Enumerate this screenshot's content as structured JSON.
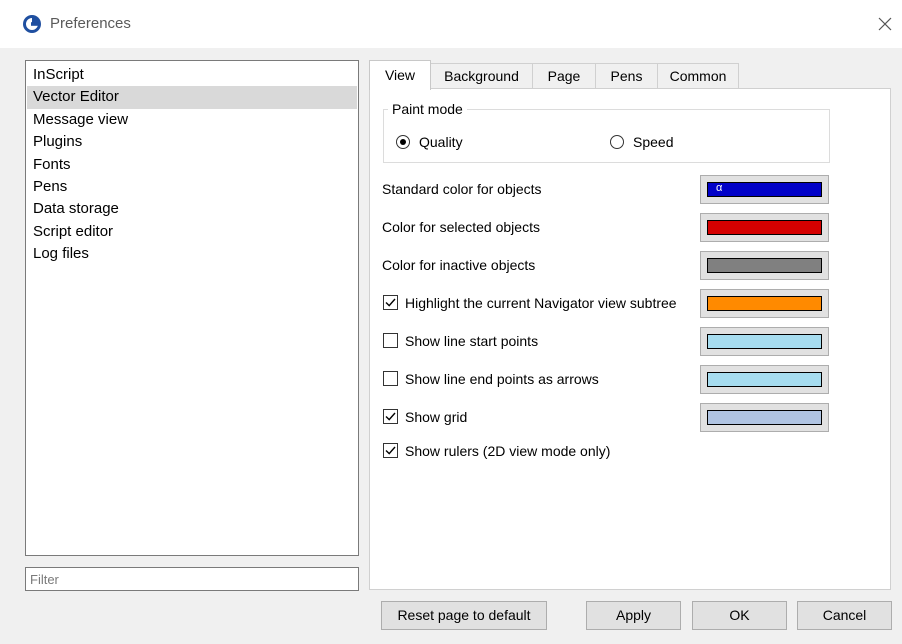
{
  "window": {
    "title": "Preferences"
  },
  "sidebar": {
    "items": [
      {
        "label": "InScript",
        "selected": false
      },
      {
        "label": "Vector Editor",
        "selected": true
      },
      {
        "label": "Message view",
        "selected": false
      },
      {
        "label": "Plugins",
        "selected": false
      },
      {
        "label": "Fonts",
        "selected": false
      },
      {
        "label": "Pens",
        "selected": false
      },
      {
        "label": "Data storage",
        "selected": false
      },
      {
        "label": "Script editor",
        "selected": false
      },
      {
        "label": "Log files",
        "selected": false
      }
    ],
    "filter_placeholder": "Filter"
  },
  "tabs": [
    {
      "label": "View",
      "active": true
    },
    {
      "label": "Background",
      "active": false
    },
    {
      "label": "Page",
      "active": false
    },
    {
      "label": "Pens",
      "active": false
    },
    {
      "label": "Common",
      "active": false
    }
  ],
  "view_tab": {
    "paint_mode": {
      "title": "Paint mode",
      "options": [
        {
          "label": "Quality",
          "checked": true
        },
        {
          "label": "Speed",
          "checked": false
        }
      ]
    },
    "colors": {
      "standard": {
        "label": "Standard color for objects",
        "color": "#0000c8",
        "glyph": "α"
      },
      "selected": {
        "label": "Color for selected objects",
        "color": "#d40000"
      },
      "inactive": {
        "label": "Color for inactive objects",
        "color": "#808080"
      }
    },
    "options": {
      "highlight": {
        "label": "Highlight the current Navigator view subtree",
        "checked": true,
        "color": "#ff8a00"
      },
      "line_start": {
        "label": "Show line start points",
        "checked": false,
        "color": "#a6dcef"
      },
      "line_end": {
        "label": "Show line end points as arrows",
        "checked": false,
        "color": "#a6dcef"
      },
      "grid": {
        "label": "Show grid",
        "checked": true,
        "color": "#b0c4e2"
      },
      "rulers": {
        "label": "Show rulers (2D view mode only)",
        "checked": true
      }
    }
  },
  "buttons": {
    "reset": "Reset page to default",
    "apply": "Apply",
    "ok": "OK",
    "cancel": "Cancel"
  }
}
